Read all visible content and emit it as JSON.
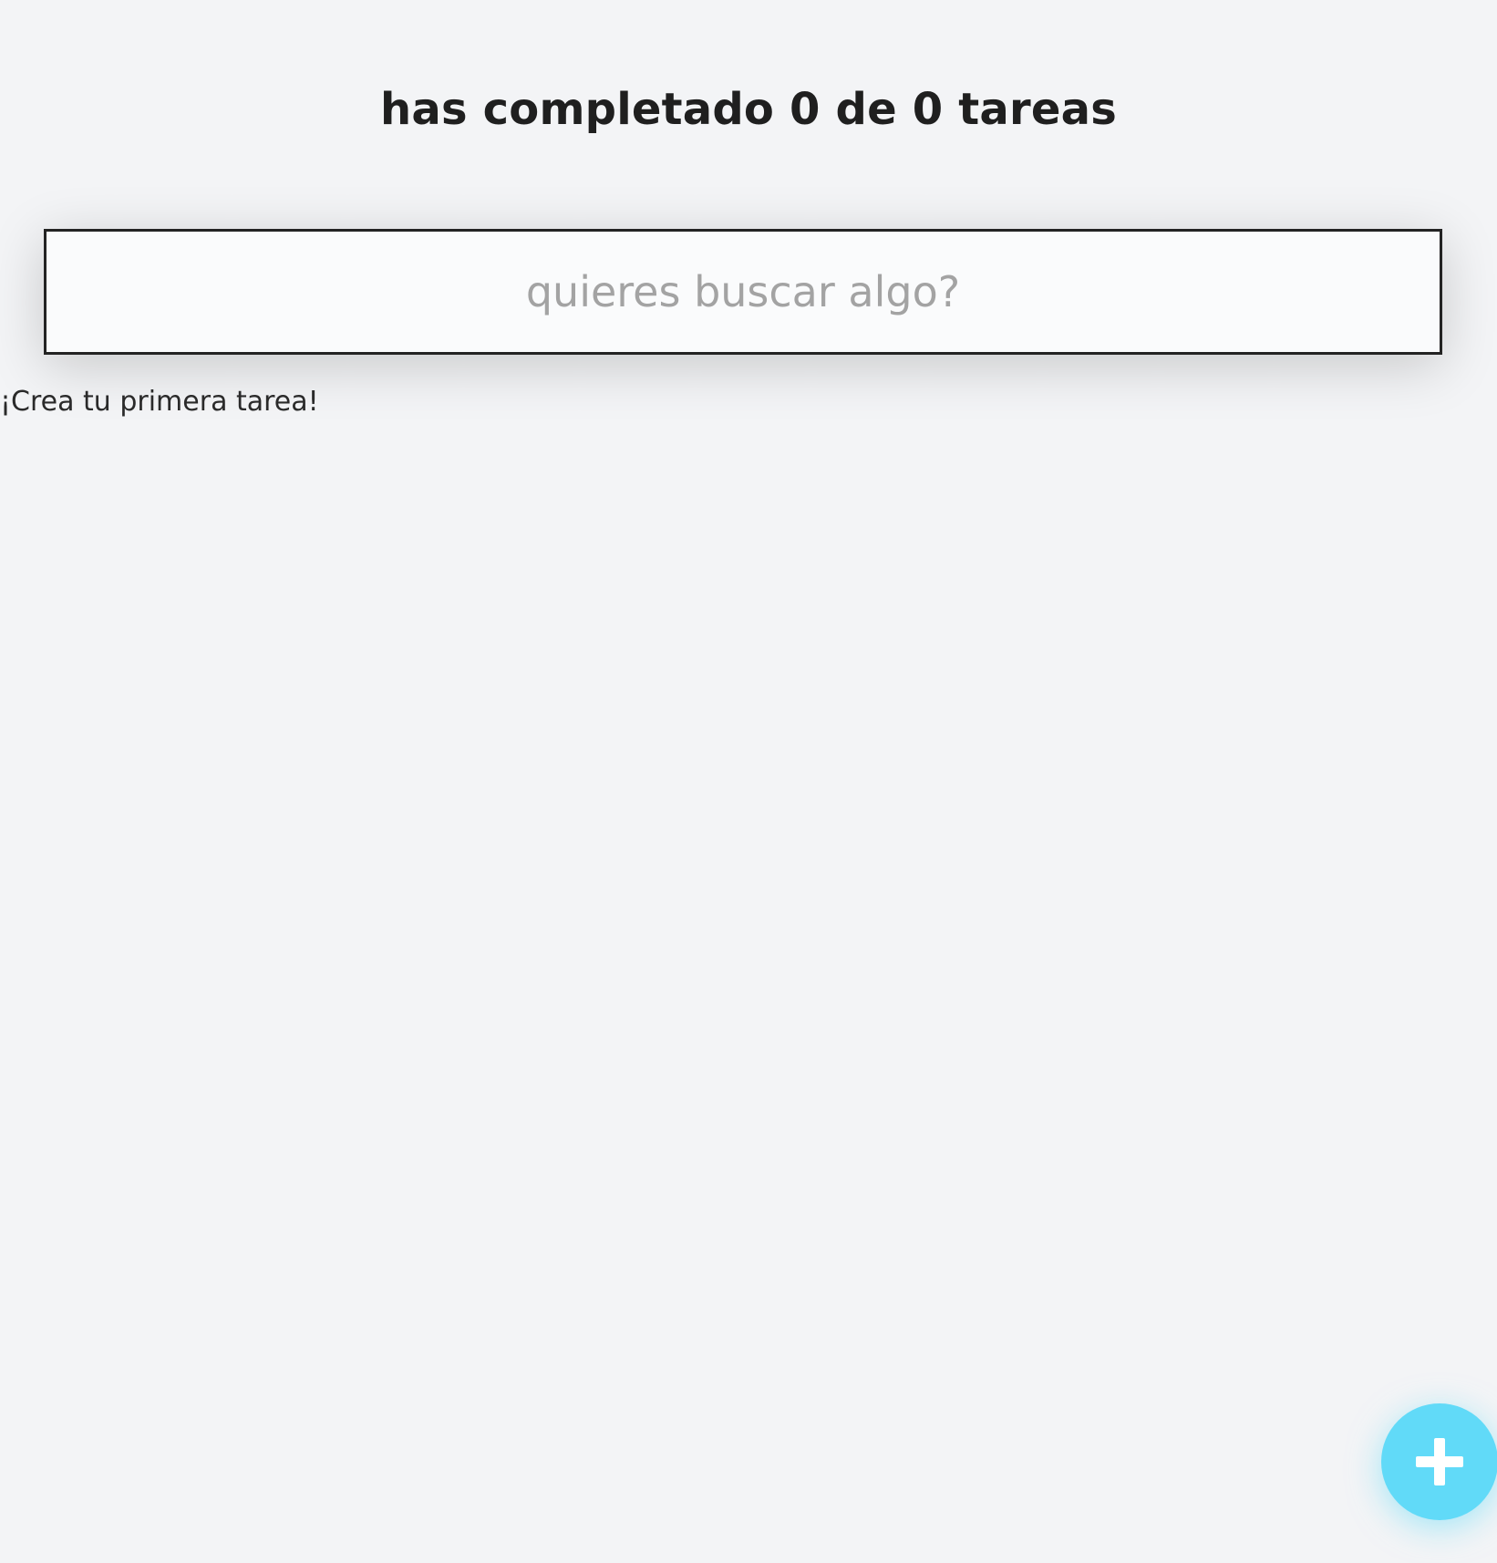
{
  "header": {
    "title": "has completado 0 de 0 tareas",
    "completed_count": 0,
    "total_count": 0
  },
  "search": {
    "placeholder": "quieres buscar algo?",
    "value": ""
  },
  "list": {
    "empty_message": "¡Crea tu primera tarea!"
  },
  "fab": {
    "icon": "plus-icon",
    "color": "#61daf8"
  },
  "colors": {
    "background": "#f3f4f6",
    "text": "#1f1f1f",
    "accent": "#61daf8"
  }
}
